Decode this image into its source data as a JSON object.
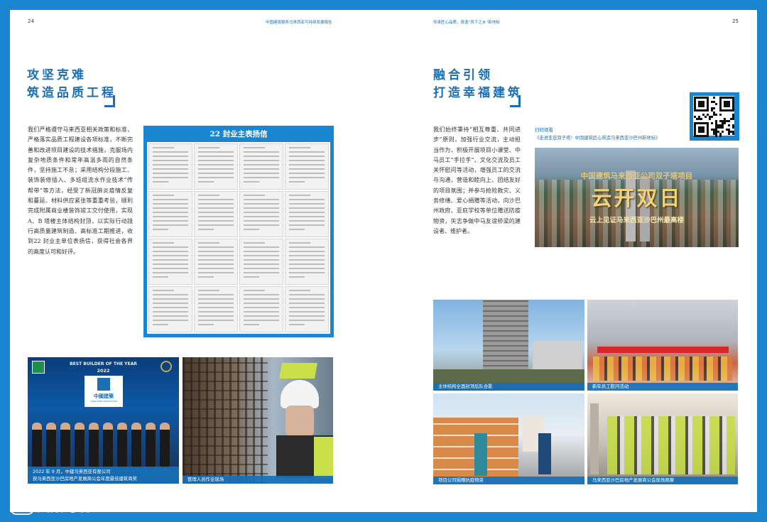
{
  "left_page": {
    "page_number": "24",
    "header": "中国建筑服务马来西亚可持续发展报告",
    "title_lines": [
      "攻坚克难",
      "筑造品质工程"
    ],
    "body": "我们严格遵守马来西亚相关政策和标准，严格落实品质工程建设各项标准，不断完善和改进项目建设的技术措施，克服场内复杂地质条件和常年高温多雨的自然条件，坚持施工不怠；采用结构分段施工、装饰装修插入、多班组流水作业技术“传帮带”等方法，经受了新冠肺炎疫情反复和蔓延、材料供应紧张等重重考验，顺利完成附属商业楼装饰竣工交付使用，实现 A、B 塔楼主体结构封顶，以实际行动践行高质量建筑制造、高标准工期推进，收到22 封业主单位表扬信，获得社会各界的高度认可和好评。",
    "letters_title": "22 封业主表扬信",
    "award": {
      "banner": "BEST BUILDER OF THE YEAR",
      "year": "2022",
      "logo_text": "中國建築",
      "logo_sub": "CHINA STATE CONSTRUCTION",
      "caption_line1": "2022 年 9 月，中建马来西亚有限公司",
      "caption_line2": "获马来西亚沙巴房地产发展商公会年度最佳建筑商奖"
    },
    "worker_caption": "管理人员作业现场"
  },
  "right_page": {
    "page_number": "25",
    "header": "传承匠心品质，筑造“风下之乡”新地标",
    "title_lines": [
      "融合引领",
      "打造幸福建筑"
    ],
    "body": "我们始终秉持“相互尊重、共同进步”原则，加强行业交流，主动担当作为，积极开展项目小课堂、中马员工“手拉手”、文化交流及员工关怀慰问等活动，增强员工的交流与沟通，营造和睦向上、团结友好的项目氛围；并参与抢险救灾、义务修缮、爱心捐赠等活动，向沙巴州政府、亚庇学校等单位赠送防疫物资，矢志争做中马友谊桥梁的建设者、维护者。",
    "scan_label": "扫码观看",
    "video_title": "《走进亚庇双子塔！中国建筑匠心筑造马来西亚沙巴州新地标》",
    "video_overlay_top": "中国建筑马来西亚公司双子塔项目",
    "video_overlay_big": "云开双日",
    "video_overlay_bottom": "云上见证马来西亚沙巴州最高楼",
    "photos": [
      {
        "caption": "主体结构全面封顶后队合影"
      },
      {
        "caption": "新年员工慰问活动"
      },
      {
        "caption": "项目公司捐赠抗疫物资"
      },
      {
        "caption": "马来西亚沙巴房地产发展商公会现场观摩"
      }
    ]
  },
  "watermark": "大数跨境"
}
